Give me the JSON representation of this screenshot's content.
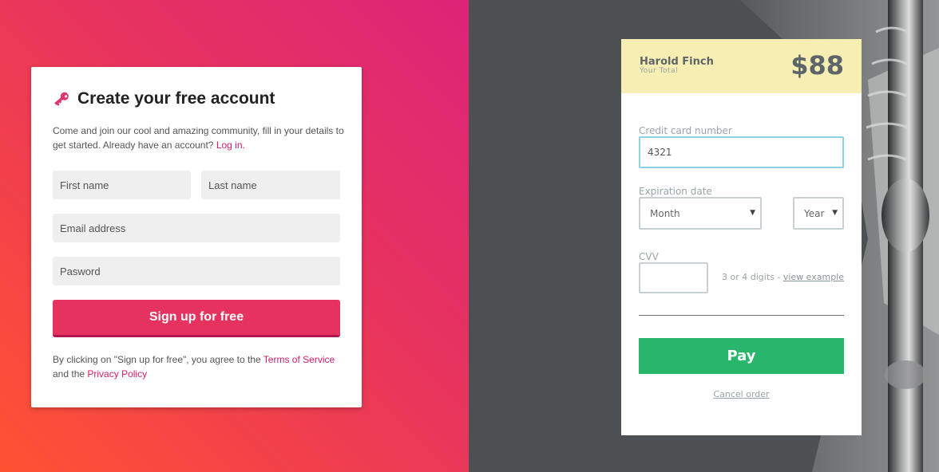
{
  "signup": {
    "title": "Create your free account",
    "intro_text": "Come and join our cool and amazing community, fill in your details to get started. Already have an account?",
    "login_link": "Log in.",
    "first_name_placeholder": "First name",
    "last_name_placeholder": "Last name",
    "email_placeholder": "Email address",
    "password_placeholder": "Pasword",
    "button_label": "Sign up for free",
    "terms_prefix": "By clicking on \"Sign up for free\", you agree to the",
    "terms_link": "Terms of Service",
    "terms_mid": "and the",
    "privacy_link": "Privacy Policy",
    "accent_color": "#e6325f"
  },
  "payment": {
    "payer_name": "Harold Finch",
    "payer_sub": "Your Total",
    "total": "$88",
    "cc_label": "Credit card number",
    "cc_value": "4321",
    "expiry_label": "Expiration date",
    "month_value": "Month",
    "year_value": "Year",
    "cvv_label": "CVV",
    "cvv_hint": "3 or 4 digits -",
    "cvv_link": "view example",
    "pay_label": "Pay",
    "cancel_label": "Cancel order",
    "pay_color": "#28b76a",
    "header_color": "#f7eeb4"
  }
}
